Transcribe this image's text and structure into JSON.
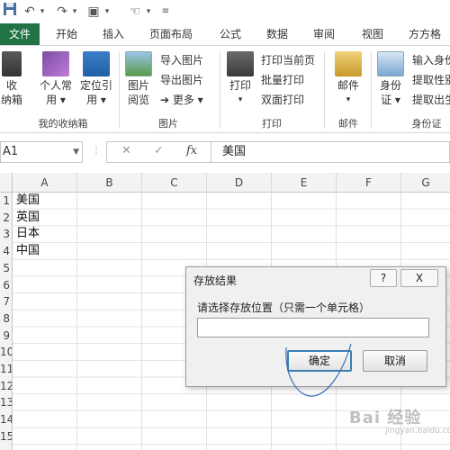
{
  "quick_access": {
    "icons": [
      "save-icon",
      "undo-icon",
      "redo-icon",
      "screenshot-icon",
      "touch-mode-icon",
      "customize-icon"
    ]
  },
  "ribbon_tabs": {
    "file": "文件",
    "tabs": [
      "开始",
      "插入",
      "页面布局",
      "公式",
      "数据",
      "审阅",
      "视图",
      "方方格子"
    ]
  },
  "ribbon": {
    "group1": {
      "label": "我的收纳箱",
      "btn1_l1": "收",
      "btn1_l2": "纳箱",
      "btn2_l1": "个人常",
      "btn2_l2": "用 ▾",
      "btn3_l1": "定位引",
      "btn3_l2": "用 ▾"
    },
    "group2": {
      "label": "图片",
      "big_l1": "图片",
      "big_l2": "阅览",
      "import": "导入图片",
      "export": "导出图片",
      "more": "➔ 更多 ▾"
    },
    "group3": {
      "label": "打印",
      "big": "打印",
      "big_dd": "▾",
      "print_current": "打印当前页",
      "batch_print": "批量打印",
      "duplex_print": "双面打印"
    },
    "group4": {
      "label": "邮件",
      "big": "邮件",
      "big_dd": "▾"
    },
    "group5": {
      "label": "身份证",
      "big_l1": "身份",
      "big_l2": "证 ▾",
      "input_id": "输入身份",
      "extract_gender": "提取性别",
      "extract_birth": "提取出生"
    }
  },
  "formula_bar": {
    "name_box": "A1",
    "cancel": "✕",
    "enter": "✓",
    "fx": "fx",
    "content": "美国"
  },
  "grid": {
    "columns": [
      "A",
      "B",
      "C",
      "D",
      "E",
      "F",
      "G"
    ],
    "rows": [
      "1",
      "2",
      "3",
      "4",
      "5",
      "6",
      "7",
      "8",
      "9",
      "10",
      "11",
      "12",
      "13",
      "14",
      "15"
    ],
    "cells": [
      "美国",
      "英国",
      "日本",
      "中国"
    ]
  },
  "dialog": {
    "title": "存放结果",
    "help": "?",
    "close": "X",
    "prompt": "请选择存放位置（只需一个单元格）",
    "input_value": "",
    "ok": "确定",
    "cancel": "取消"
  },
  "watermark": {
    "brand": "Bai 经验",
    "url": "jingyan.baidu.com"
  },
  "colors": {
    "accent": "#217346",
    "dialog_bg": "#f0f0f0",
    "focus_border": "#3c7fb1"
  }
}
